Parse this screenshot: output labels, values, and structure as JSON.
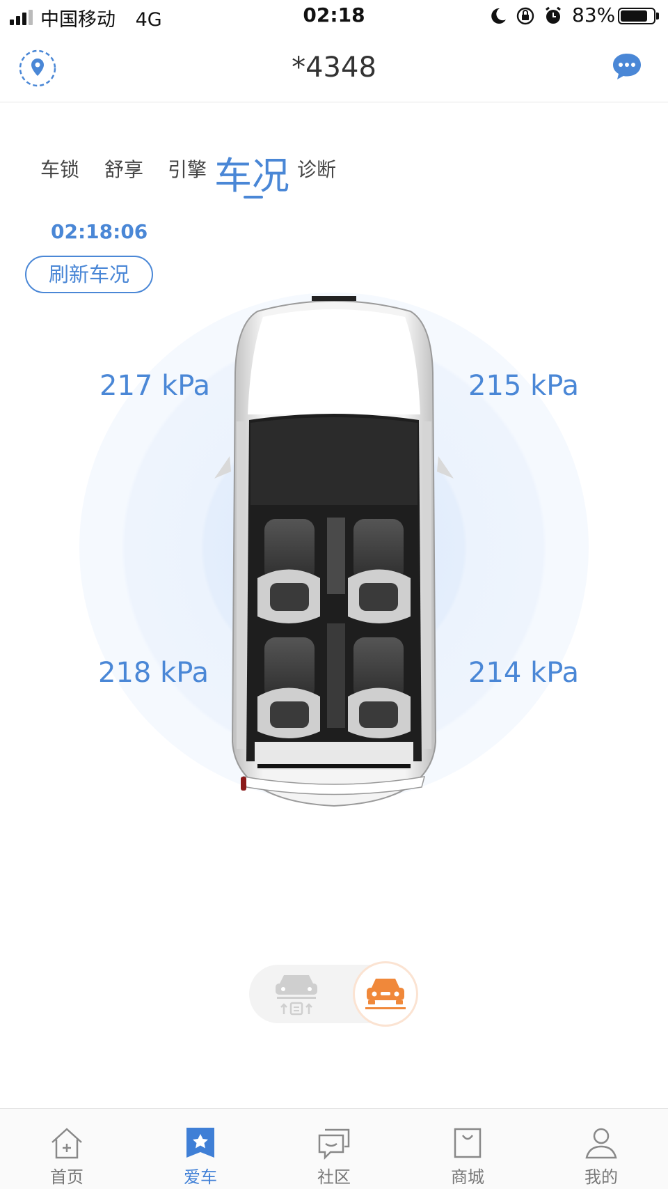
{
  "status_bar": {
    "carrier": "中国移动",
    "network": "4G",
    "time": "02:18",
    "battery": "83%",
    "battery_level": 0.83
  },
  "header": {
    "title": "*4348",
    "left_icon": "location-pin-icon",
    "right_icon": "message-icon"
  },
  "tabs": [
    {
      "label": "车锁",
      "active": false
    },
    {
      "label": "舒享",
      "active": false
    },
    {
      "label": "引擎",
      "active": false
    },
    {
      "label": "车况",
      "active": true
    },
    {
      "label": "诊断",
      "active": false
    }
  ],
  "status": {
    "update_time": "02:18:06",
    "refresh_label": "刷新车况"
  },
  "tires": {
    "front_left": "217 kPa",
    "front_right": "215 kPa",
    "rear_left": "218 kPa",
    "rear_right": "214 kPa"
  },
  "mode_switch": {
    "left_icon": "car-lift-icon",
    "right_icon": "car-front-icon",
    "active": "right"
  },
  "nav": [
    {
      "label": "首页",
      "icon": "home-icon",
      "active": false
    },
    {
      "label": "爱车",
      "icon": "star-bookmark-icon",
      "active": true
    },
    {
      "label": "社区",
      "icon": "community-icon",
      "active": false
    },
    {
      "label": "商城",
      "icon": "shopping-bag-icon",
      "active": false
    },
    {
      "label": "我的",
      "icon": "user-icon",
      "active": false
    }
  ],
  "colors": {
    "accent": "#4a87d6",
    "orange": "#f0883a"
  }
}
